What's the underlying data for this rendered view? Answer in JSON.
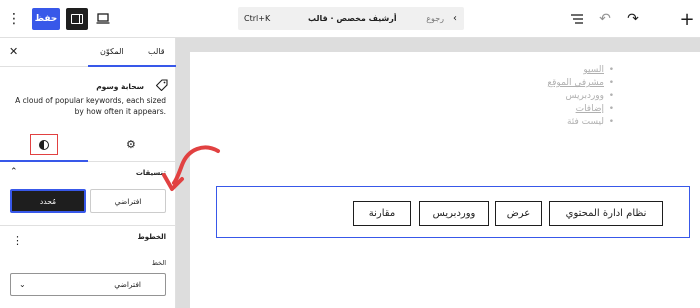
{
  "topbar": {
    "save_label": "حفظ",
    "command_shortcut": "Ctrl+K",
    "command_title": "أرشيف مخصص · قالب",
    "command_back": "رجوع"
  },
  "sidebar": {
    "tabs": {
      "template": "قالب",
      "block": "المكوّن"
    },
    "block": {
      "title": "سحابة وسوم",
      "description": "A cloud of popular keywords, each sized by how often it appears."
    },
    "variations": {
      "title": "تنسيقات",
      "default_label": "افتراضي",
      "selected_label": "مُحدد"
    },
    "typography": {
      "title": "الخطوط",
      "font_label": "الخط",
      "font_value": "افتراضي"
    }
  },
  "canvas": {
    "tags_list": [
      {
        "text": "السيو",
        "link": true
      },
      {
        "text": "مشرفي الموقع",
        "link": true
      },
      {
        "text": "ووردبريس",
        "link": false
      },
      {
        "text": "إضافات",
        "link": true
      },
      {
        "text": "ليست فئة",
        "link": false
      }
    ],
    "tag_cloud": [
      "نظام ادارة المحتوي",
      "عرض",
      "ووردبريس",
      "مقارنة"
    ]
  },
  "colors": {
    "accent": "#3858e9",
    "annotation": "#e14141"
  }
}
